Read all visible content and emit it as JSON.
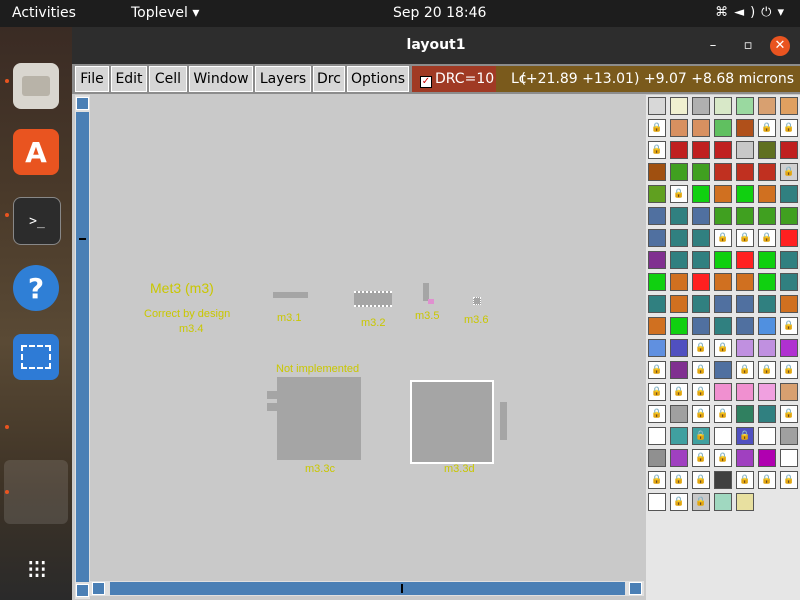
{
  "topbar": {
    "activities": "Activities",
    "app_menu": "Toplevel ▾",
    "clock": "Sep 20  18:46",
    "tray_icons": [
      "network-icon",
      "volume-icon",
      "power-icon",
      "chevron-down-icon"
    ]
  },
  "dock": {
    "items": [
      "files",
      "software",
      "terminal",
      "help",
      "screenshot",
      "window",
      "apps"
    ],
    "terminal_glyph": ">_",
    "help_glyph": "?",
    "store_glyph": "A",
    "apps_glyph": "⁝⁝⁝"
  },
  "window": {
    "title": "layout1",
    "controls": {
      "min": "–",
      "max": "▫",
      "close": "✕"
    },
    "menu": [
      "File",
      "Edit",
      "Cell",
      "Window",
      "Layers",
      "Drc",
      "Options"
    ],
    "drc_label": "DRC=10",
    "coord_prefix": "Lc",
    "coord_text": "(+21.89 +13.01) +9.07 +8.68 microns"
  },
  "layout": {
    "title": "Met3 (m3)",
    "subtitle_1": "Correct by design",
    "subtitle_2": "m3.4",
    "labels": [
      "m3.1",
      "m3.2",
      "m3.5",
      "m3.6"
    ],
    "not_impl": "Not implemented",
    "m3c": "m3.3c",
    "m3d": "m3.3d"
  },
  "palette": {
    "colors": [
      "#d8d8d8",
      "#f0f0d0",
      "#b0b0b0",
      "#d8e8c8",
      "#9ad9a0",
      "#d8a070",
      "#e0a060",
      "#ffffff",
      "#d89060",
      "#d89060",
      "#60c060",
      "#b0501a",
      "#ffffff",
      "#ffffff",
      "#ffffff",
      "#c02020",
      "#c02020",
      "#c02020",
      "#c8c8c8",
      "#607020",
      "#c02020",
      "#a05010",
      "#40a020",
      "#40a020",
      "#c03020",
      "#c03020",
      "#c03020",
      "#d0d0d0",
      "#60a020",
      "#ffffff",
      "#10d010",
      "#d07020",
      "#10d010",
      "#d07020",
      "#308080",
      "#5070a0",
      "#308080",
      "#5070a0",
      "#40a020",
      "#40a020",
      "#40a020",
      "#40a020",
      "#5070a0",
      "#308080",
      "#308080",
      "#ffffff",
      "#ffffff",
      "#ffffff",
      "#ff2020",
      "#803090",
      "#308080",
      "#308080",
      "#10d010",
      "#ff2020",
      "#10d010",
      "#308080",
      "#10d010",
      "#d07020",
      "#ff2020",
      "#d07020",
      "#d07020",
      "#10d010",
      "#308080",
      "#308080",
      "#d07020",
      "#308080",
      "#5070a0",
      "#5070a0",
      "#308080",
      "#d07020",
      "#d07020",
      "#10d010",
      "#5070a0",
      "#308080",
      "#5070a0",
      "#5090e0",
      "#ffffff",
      "#6090e0",
      "#5050c0",
      "#ffffff",
      "#ffffff",
      "#c090e0",
      "#c090e0",
      "#b030d0",
      "#ffffff",
      "#803090",
      "#ffffff",
      "#5070a0",
      "#ffffff",
      "#ffffff",
      "#ffffff",
      "#ffffff",
      "#ffffff",
      "#ffffff",
      "#f090d0",
      "#f090d0",
      "#f0a0e0",
      "#d8a070",
      "#ffffff",
      "#a0a0a0",
      "#ffffff",
      "#ffffff",
      "#308060",
      "#308080",
      "#ffffff",
      "#ffffff",
      "#40a0a0",
      "#40a0a0",
      "#ffffff",
      "#5050c0",
      "#ffffff",
      "#a0a0a0",
      "#909090",
      "#a040c0",
      "#ffffff",
      "#ffffff",
      "#a040c0",
      "#b000b0",
      "#ffffff",
      "#ffffff",
      "#ffffff",
      "#ffffff",
      "#404040",
      "#ffffff",
      "#ffffff",
      "#ffffff",
      "#ffffff",
      "#ffffff",
      "#c8c8c8",
      "#a0d8c0",
      "#e8e0a0"
    ],
    "locked": [
      7,
      12,
      13,
      14,
      27,
      29,
      45,
      46,
      47,
      76,
      79,
      80,
      84,
      86,
      88,
      89,
      90,
      91,
      92,
      93,
      98,
      100,
      101,
      104,
      107,
      109,
      114,
      115,
      119,
      120,
      121,
      123,
      124,
      125,
      127,
      128
    ]
  }
}
